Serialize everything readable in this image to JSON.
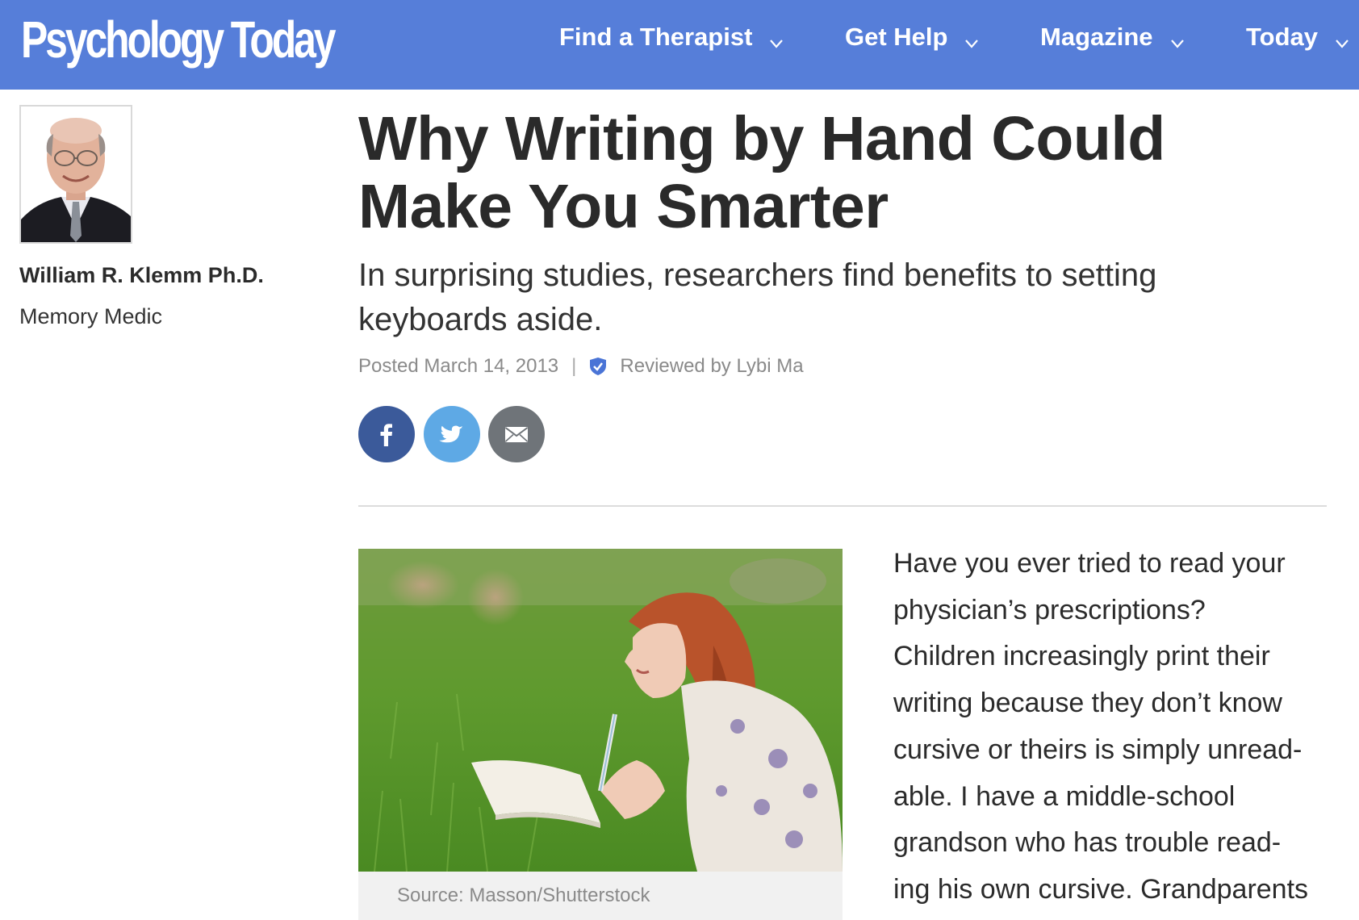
{
  "header": {
    "logo_text": "Psychology Today",
    "nav": [
      {
        "label": "Find a Therapist",
        "icon": "chevron-down-icon"
      },
      {
        "label": "Get Help",
        "icon": "chevron-down-icon"
      },
      {
        "label": "Magazine",
        "icon": "chevron-down-icon"
      },
      {
        "label": "Today",
        "icon": "chevron-down-icon"
      }
    ],
    "background_color": "#567ed9"
  },
  "author": {
    "name": "William R. Klemm Ph.D.",
    "blog": "Memory Medic",
    "photo": "author-portrait"
  },
  "article": {
    "title": "Why Writing by Hand Could Make You Smarter",
    "subtitle": "In surprising studies, researchers find benefits to setting keyboards aside.",
    "posted": "Posted March 14, 2013",
    "separator": "|",
    "reviewed": "Reviewed by Lybi Ma",
    "reviewed_icon": "verified-shield-icon",
    "share": [
      {
        "network": "facebook",
        "icon": "facebook-icon",
        "color": "#3b5a9a"
      },
      {
        "network": "twitter",
        "icon": "twitter-icon",
        "color": "#5ea9e5"
      },
      {
        "network": "email",
        "icon": "email-icon",
        "color": "#6f7479"
      }
    ],
    "image_caption": "Source: Masson/Shutterstock",
    "body_lines": [
      "Have you ever tried to read your",
      "physician’s prescriptions?",
      "Children increasingly print their",
      "writing because they don’t know",
      "cursive or theirs is simply unread-",
      "able. I have a middle-school",
      "grandson who has trouble read-",
      "ing his own cursive. Grandparents"
    ]
  }
}
